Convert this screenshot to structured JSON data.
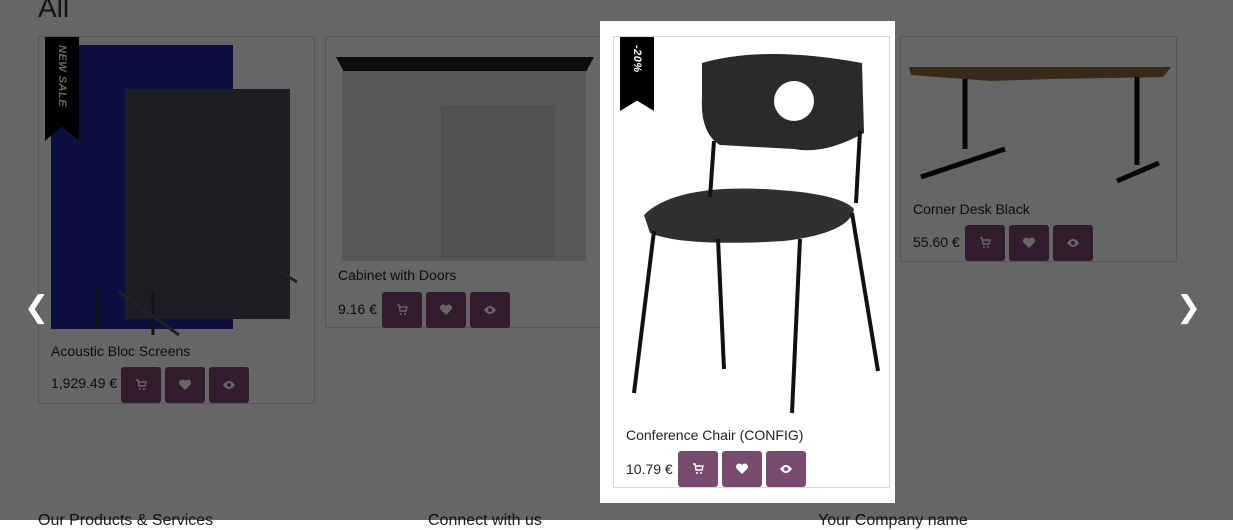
{
  "section": {
    "title": "All"
  },
  "footer": {
    "col1": "Our Products & Services",
    "col2": "Connect with us",
    "col3": "Your Company name"
  },
  "nav": {
    "prev": "❮",
    "next": "❯"
  },
  "products": [
    {
      "name": "Acoustic Bloc Screens",
      "price": "1,929.49 €",
      "ribbon": "NEW SALE"
    },
    {
      "name": "Cabinet with Doors",
      "price": "9.16 €",
      "ribbon": ""
    },
    {
      "name": "Conference Chair (CONFIG)",
      "price": "10.79 €",
      "ribbon": "-20%"
    },
    {
      "name": "Corner Desk Black",
      "price": "55.60 €",
      "ribbon": ""
    }
  ],
  "icons": {
    "cart": "cart-icon",
    "wishlist": "heart-icon",
    "quick_view": "eye-icon"
  },
  "colors": {
    "action_button": "#7a4a6e",
    "overlay": "rgba(0,0,0,0.6)"
  }
}
